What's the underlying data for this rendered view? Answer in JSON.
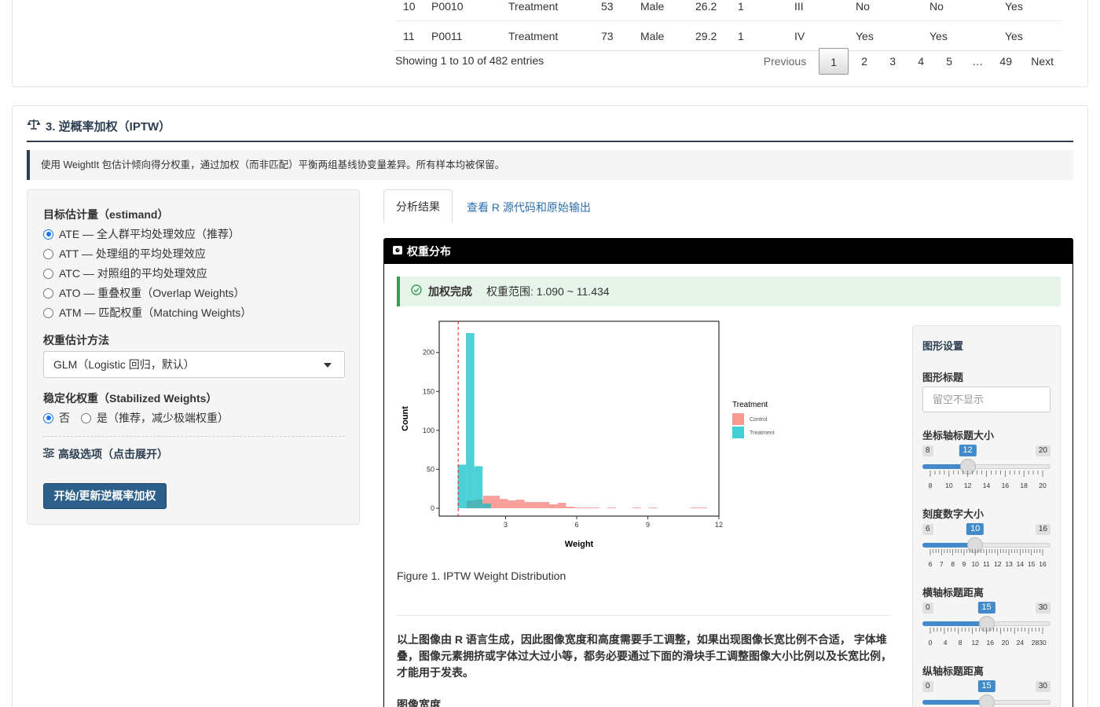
{
  "table": {
    "rows": [
      [
        "10",
        "P0010",
        "Treatment",
        "53",
        "Male",
        "26.2",
        "1",
        "III",
        "No",
        "No",
        "Yes"
      ],
      [
        "11",
        "P0011",
        "Treatment",
        "73",
        "Male",
        "29.2",
        "1",
        "IV",
        "Yes",
        "Yes",
        "Yes"
      ]
    ],
    "info": "Showing 1 to 10 of 482 entries",
    "pager": {
      "previous": "Previous",
      "pages": [
        "1",
        "2",
        "3",
        "4",
        "5",
        "…",
        "49"
      ],
      "next": "Next"
    }
  },
  "section": {
    "title": "3. 逆概率加权（IPTW）",
    "note": "使用 WeightIt 包估计倾向得分权重，通过加权（而非匹配）平衡两组基线协变量差异。所有样本均被保留。"
  },
  "left": {
    "estimand_label": "目标估计量（estimand）",
    "estimand_options": [
      "ATE — 全人群平均处理效应（推荐）",
      "ATT — 处理组的平均处理效应",
      "ATC — 对照组的平均处理效应",
      "ATO — 重叠权重（Overlap Weights）",
      "ATM — 匹配权重（Matching Weights）"
    ],
    "method_label": "权重估计方法",
    "method_value": "GLM（Logistic 回归，默认）",
    "stabilized_label": "稳定化权重（Stabilized Weights）",
    "stabilized_no": "否",
    "stabilized_yes": "是（推荐，减少极端权重）",
    "advanced": "高级选项（点击展开）",
    "run_button": "开始/更新逆概率加权"
  },
  "tabs": {
    "results": "分析结果",
    "source": "查看 R 源代码和原始输出"
  },
  "result": {
    "header": "权重分布",
    "status_label": "加权完成",
    "status_range": "权重范围: 1.090 ~ 11.434",
    "caption": "Figure 1. IPTW Weight Distribution",
    "warning": "以上图像由 R 语言生成，因此图像宽度和高度需要手工调整，如果出现图像长宽比例不合适， 字体堆叠，图像元素拥挤或字体过大过小等，都务必要通过下面的滑块手工调整图像大小比例以及长宽比例，才能用于发表。",
    "img_width_label": "图像宽度"
  },
  "settings": {
    "title": "图形设置",
    "plot_title_label": "图形标题",
    "plot_title_placeholder": "留空不显示",
    "sliders": [
      {
        "label": "坐标轴标题大小",
        "min": 8,
        "max": 20,
        "value": 12,
        "ticks": [
          "8",
          "10",
          "12",
          "14",
          "16",
          "18",
          "20"
        ]
      },
      {
        "label": "刻度数字大小",
        "min": 6,
        "max": 16,
        "value": 10,
        "ticks": [
          "6",
          "7",
          "8",
          "9",
          "10",
          "11",
          "12",
          "13",
          "14",
          "15",
          "16"
        ]
      },
      {
        "label": "横轴标题距离",
        "min": 0,
        "max": 30,
        "value": 15,
        "ticks": [
          "0",
          "4",
          "8",
          "12",
          "16",
          "20",
          "24",
          "28",
          "30"
        ]
      },
      {
        "label": "纵轴标题距离",
        "min": 0,
        "max": 30,
        "value": 15,
        "ticks": []
      }
    ]
  },
  "chart_data": {
    "type": "histogram",
    "xlabel": "Weight",
    "ylabel": "Count",
    "xlim": [
      0.2,
      12
    ],
    "ylim": [
      0,
      232
    ],
    "x_ticks": [
      3,
      6,
      9,
      12
    ],
    "y_ticks": [
      0,
      50,
      100,
      150,
      200
    ],
    "legend_title": "Treatment",
    "legend_position": "right",
    "reference_line_x": 1,
    "series": [
      {
        "name": "Control",
        "color": "#F8766D",
        "bins": [
          {
            "x0": 1.0,
            "x1": 1.35,
            "count": 0
          },
          {
            "x0": 1.35,
            "x1": 1.7,
            "count": 10
          },
          {
            "x0": 1.7,
            "x1": 2.05,
            "count": 11
          },
          {
            "x0": 2.05,
            "x1": 2.4,
            "count": 16
          },
          {
            "x0": 2.4,
            "x1": 2.75,
            "count": 16
          },
          {
            "x0": 2.75,
            "x1": 3.1,
            "count": 12
          },
          {
            "x0": 3.1,
            "x1": 3.45,
            "count": 10
          },
          {
            "x0": 3.45,
            "x1": 3.8,
            "count": 11
          },
          {
            "x0": 3.8,
            "x1": 4.15,
            "count": 8
          },
          {
            "x0": 4.15,
            "x1": 4.5,
            "count": 8
          },
          {
            "x0": 4.5,
            "x1": 4.85,
            "count": 8
          },
          {
            "x0": 4.85,
            "x1": 5.2,
            "count": 5
          },
          {
            "x0": 5.2,
            "x1": 5.55,
            "count": 7
          },
          {
            "x0": 5.55,
            "x1": 5.9,
            "count": 2
          },
          {
            "x0": 5.9,
            "x1": 6.25,
            "count": 1
          },
          {
            "x0": 6.25,
            "x1": 6.6,
            "count": 1
          },
          {
            "x0": 6.6,
            "x1": 6.95,
            "count": 1
          },
          {
            "x0": 7.3,
            "x1": 7.65,
            "count": 1
          },
          {
            "x0": 8.35,
            "x1": 8.7,
            "count": 1
          },
          {
            "x0": 9.05,
            "x1": 9.4,
            "count": 1
          },
          {
            "x0": 10.8,
            "x1": 11.15,
            "count": 1
          },
          {
            "x0": 11.15,
            "x1": 11.5,
            "count": 1
          }
        ]
      },
      {
        "name": "Treatment",
        "color": "#00BFC4",
        "bins": [
          {
            "x0": 0.98,
            "x1": 1.33,
            "count": 56
          },
          {
            "x0": 1.33,
            "x1": 1.68,
            "count": 225
          },
          {
            "x0": 1.68,
            "x1": 2.03,
            "count": 54
          },
          {
            "x0": 2.03,
            "x1": 2.38,
            "count": 6
          }
        ]
      }
    ]
  }
}
